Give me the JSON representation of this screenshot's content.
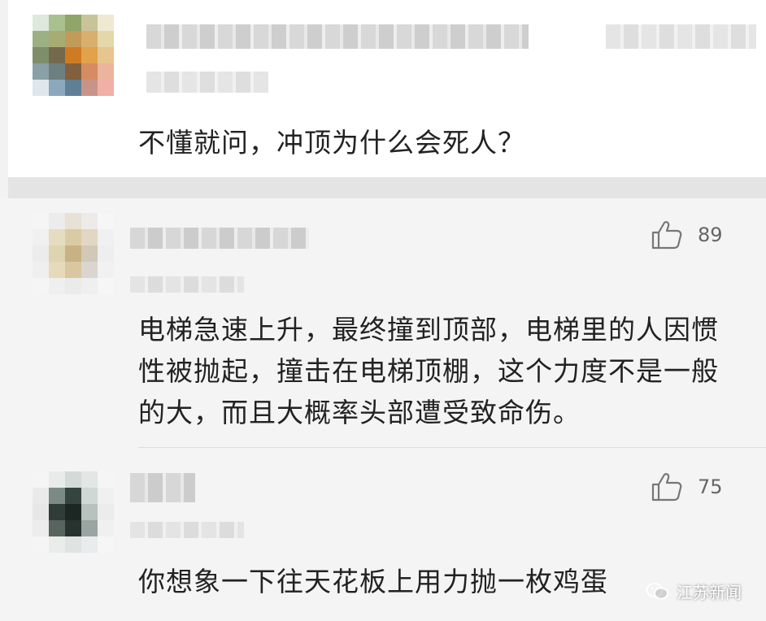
{
  "post": {
    "question": "不懂就问，冲顶为什么会死人？"
  },
  "comments": [
    {
      "text": "电梯急速上升，最终撞到顶部，电梯里的人因惯性被抛起，撞击在电梯顶棚，这个力度不是一般的大，而且大概率头部遭受致命伤。",
      "likes": "89"
    },
    {
      "text": "你想象一下往天花板上用力抛一枚鸡蛋",
      "likes": "75"
    }
  ],
  "watermark": {
    "label": "江苏新闻"
  },
  "icons": {
    "like": "thumbs-up-icon",
    "watermark": "wechat-channel-icon"
  },
  "colors": {
    "background": "#f4f4f4",
    "text": "#222222",
    "muted": "#666666"
  }
}
